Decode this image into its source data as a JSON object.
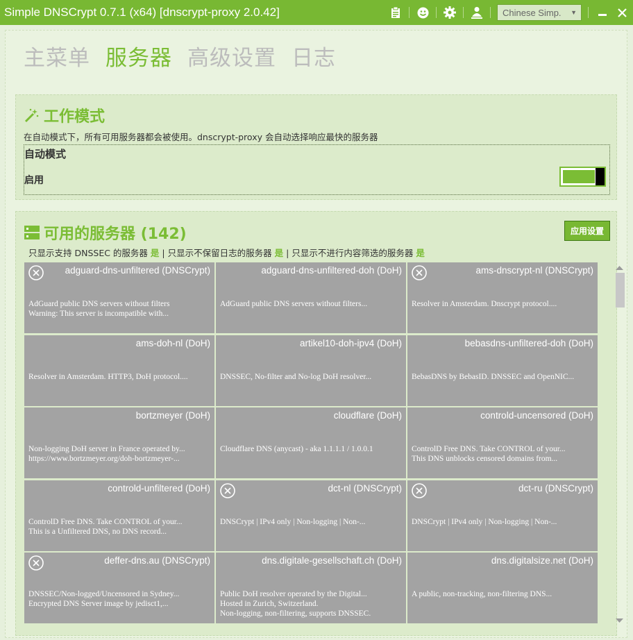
{
  "titlebar": {
    "title": "Simple DNSCrypt 0.7.1 (x64) [dnscrypt-proxy 2.0.42]",
    "icons": [
      "clipboard-icon",
      "smiley-icon",
      "gear-icon",
      "user-upload-icon"
    ],
    "language": "Chinese Simp.",
    "minimize": "minimize-icon",
    "close": "close-icon"
  },
  "nav": [
    "主菜单",
    "服务器",
    "高级设置",
    "日志"
  ],
  "nav_active": 1,
  "work_mode": {
    "title": "工作模式",
    "desc": "在自动模式下，所有可用服务器都会被使用。dnscrypt-proxy 会自动选择响应最快的服务器",
    "mode_label": "自动模式",
    "enable_label": "启用",
    "enabled": true
  },
  "servers": {
    "title": "可用的服务器 (142)",
    "apply_label": "应用设置",
    "filter_dnssec": "只显示支持 DNSSEC 的服务器",
    "filter_nolog": "只显示不保留日志的服务器",
    "filter_nofilter": "只显示不进行内容筛选的服务器",
    "yes": "是",
    "sep": "|",
    "list": [
      {
        "name": "adguard-dns-unfiltered (DNSCrypt)",
        "desc": "AdGuard public DNS servers without filters\nWarning: This server is incompatible with...",
        "icon": true
      },
      {
        "name": "adguard-dns-unfiltered-doh (DoH)",
        "desc": "AdGuard public DNS servers without filters...",
        "icon": false
      },
      {
        "name": "ams-dnscrypt-nl (DNSCrypt)",
        "desc": "Resolver in Amsterdam. Dnscrypt protocol....",
        "icon": true
      },
      {
        "name": "ams-doh-nl (DoH)",
        "desc": "Resolver in Amsterdam. HTTP3, DoH protocol....",
        "icon": false
      },
      {
        "name": "artikel10-doh-ipv4 (DoH)",
        "desc": "DNSSEC, No-filter and No-log DoH resolver...",
        "icon": false
      },
      {
        "name": "bebasdns-unfiltered-doh (DoH)",
        "desc": "BebasDNS by BebasID. DNSSEC and OpenNIC...",
        "icon": false
      },
      {
        "name": "bortzmeyer (DoH)",
        "desc": "Non-logging DoH server in France operated by...\nhttps://www.bortzmeyer.org/doh-bortzmeyer-...",
        "icon": false
      },
      {
        "name": "cloudflare (DoH)",
        "desc": "Cloudflare DNS (anycast) - aka 1.1.1.1 / 1.0.0.1",
        "icon": false
      },
      {
        "name": "controld-uncensored (DoH)",
        "desc": "ControlD Free DNS. Take CONTROL of your...\nThis DNS unblocks censored domains from...",
        "icon": false
      },
      {
        "name": "controld-unfiltered (DoH)",
        "desc": "ControlD Free DNS. Take CONTROL of your...\nThis is a Unfiltered DNS, no DNS record...",
        "icon": false
      },
      {
        "name": "dct-nl (DNSCrypt)",
        "desc": "DNSCrypt | IPv4 only | Non-logging | Non-...",
        "icon": true
      },
      {
        "name": "dct-ru (DNSCrypt)",
        "desc": "DNSCrypt | IPv4 only | Non-logging | Non-...",
        "icon": true
      },
      {
        "name": "deffer-dns.au (DNSCrypt)",
        "desc": "DNSSEC/Non-logged/Uncensored in Sydney...\nEncrypted DNS Server image by jedisct1,...",
        "icon": true
      },
      {
        "name": "dns.digitale-gesellschaft.ch (DoH)",
        "desc": "Public DoH resolver operated by the Digital...\nHosted in Zurich, Switzerland.\nNon-logging, non-filtering, supports DNSSEC.",
        "icon": false
      },
      {
        "name": "dns.digitalsize.net (DoH)",
        "desc": "A public, non-tracking, non-filtering DNS...",
        "icon": false
      }
    ]
  },
  "colors": {
    "accent": "#78b833",
    "tile": "#a3a3a3",
    "background": "#e6f0dc"
  }
}
